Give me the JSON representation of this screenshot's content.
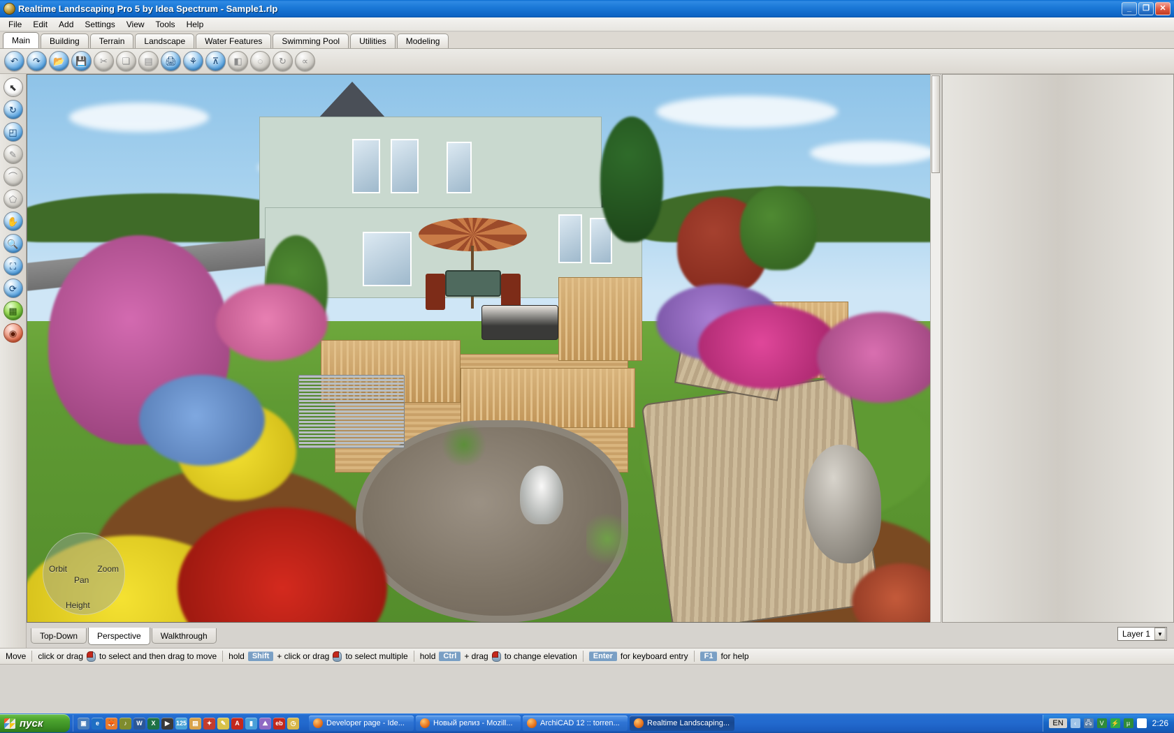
{
  "window": {
    "title": "Realtime Landscaping Pro 5 by Idea Spectrum - Sample1.rlp",
    "app_icon": "app-globe-icon",
    "controls": {
      "minimize": "_",
      "restore": "❐",
      "close": "✕"
    }
  },
  "menu": {
    "items": [
      "File",
      "Edit",
      "Add",
      "Settings",
      "View",
      "Tools",
      "Help"
    ]
  },
  "tabs": {
    "active": "Main",
    "items": [
      "Main",
      "Building",
      "Terrain",
      "Landscape",
      "Water Features",
      "Swimming Pool",
      "Utilities",
      "Modeling"
    ]
  },
  "toolbar_top": {
    "buttons": [
      {
        "name": "undo-icon",
        "glyph": "↶",
        "enabled": true
      },
      {
        "name": "redo-icon",
        "glyph": "↷",
        "enabled": true
      },
      {
        "name": "open-file-icon",
        "glyph": "📂",
        "enabled": true
      },
      {
        "name": "save-icon",
        "glyph": "💾",
        "enabled": true
      },
      {
        "name": "cut-icon",
        "glyph": "✂",
        "enabled": false
      },
      {
        "name": "copy-icon",
        "glyph": "❏",
        "enabled": false
      },
      {
        "name": "paste-icon",
        "glyph": "▤",
        "enabled": false
      },
      {
        "name": "print-icon",
        "glyph": "🖨",
        "enabled": true
      },
      {
        "name": "plant-icon",
        "glyph": "⚘",
        "enabled": true
      },
      {
        "name": "align-icon",
        "glyph": "⊼",
        "enabled": true
      },
      {
        "name": "mirror-icon",
        "glyph": "◧",
        "enabled": false
      },
      {
        "name": "shape-icon",
        "glyph": "◌",
        "enabled": false
      },
      {
        "name": "rotate-icon",
        "glyph": "↻",
        "enabled": false
      },
      {
        "name": "group-icon",
        "glyph": "∝",
        "enabled": false
      }
    ]
  },
  "toolbar_left": {
    "buttons": [
      {
        "name": "select-arrow-icon",
        "glyph": "⬉",
        "style": "white"
      },
      {
        "name": "rotate-tool-icon",
        "glyph": "↻",
        "style": "blue"
      },
      {
        "name": "scale-tool-icon",
        "glyph": "◰",
        "style": "blue"
      },
      {
        "name": "polyline-tool-icon",
        "glyph": "✎",
        "style": "dim"
      },
      {
        "name": "curve-tool-icon",
        "glyph": "⌒",
        "style": "dim"
      },
      {
        "name": "region-tool-icon",
        "glyph": "⬠",
        "style": "dim"
      },
      {
        "name": "pan-tool-icon",
        "glyph": "✋",
        "style": "blue"
      },
      {
        "name": "zoom-tool-icon",
        "glyph": "🔍",
        "style": "blue"
      },
      {
        "name": "zoom-window-icon",
        "glyph": "⛶",
        "style": "blue"
      },
      {
        "name": "orbit-tool-icon",
        "glyph": "⟳",
        "style": "blue"
      },
      {
        "name": "terrain-grid-icon",
        "glyph": "▦",
        "style": "green"
      },
      {
        "name": "render-tool-icon",
        "glyph": "◉",
        "style": "red"
      }
    ]
  },
  "viewport": {
    "nav_compass": {
      "orbit": "Orbit",
      "zoom": "Zoom",
      "pan": "Pan",
      "height": "Height"
    },
    "scene_description": "3D rendered landscape design: two-story house with wooden deck, patio umbrella, table and chairs, rock pond with fountain, flower beds, garden bench, pergola, stone boulder, mulch beds and lawn"
  },
  "view_tabs": {
    "active": "Perspective",
    "items": [
      "Top-Down",
      "Perspective",
      "Walkthrough"
    ]
  },
  "layer_selector": {
    "value": "Layer 1",
    "arrow": "▼"
  },
  "status_bar": {
    "mode": "Move",
    "hints": [
      {
        "pre": "click or drag",
        "key": "",
        "mid": "",
        "post": "to select and then drag to move",
        "mouse": true
      },
      {
        "pre": "hold",
        "key": "Shift",
        "mid": "+ click or drag",
        "post": "to select multiple",
        "mouse": true
      },
      {
        "pre": "hold",
        "key": "Ctrl",
        "mid": "+ drag",
        "post": "to change elevation",
        "mouse": true
      },
      {
        "pre": "",
        "key": "Enter",
        "mid": "",
        "post": "for keyboard entry",
        "mouse": false
      },
      {
        "pre": "",
        "key": "F1",
        "mid": "",
        "post": "for help",
        "mouse": false
      }
    ]
  },
  "taskbar": {
    "start_label": "пуск",
    "quicklaunch": [
      {
        "name": "show-desktop-icon",
        "glyph": "▣",
        "color": "#4a7ebb"
      },
      {
        "name": "internet-explorer-icon",
        "glyph": "e",
        "color": "#1f6fc4"
      },
      {
        "name": "firefox-icon",
        "glyph": "🦊",
        "color": "#e8792a"
      },
      {
        "name": "winamp-icon",
        "glyph": "♪",
        "color": "#7f8c2e"
      },
      {
        "name": "word-icon",
        "glyph": "W",
        "color": "#2b5797"
      },
      {
        "name": "excel-icon",
        "glyph": "X",
        "color": "#1e7145"
      },
      {
        "name": "media-player-icon",
        "glyph": "▶",
        "color": "#3a3a3a"
      },
      {
        "name": "k-lite-icon",
        "glyph": "125",
        "color": "#4aa3d8"
      },
      {
        "name": "explorer-folder-icon",
        "glyph": "▤",
        "color": "#d8a24a"
      },
      {
        "name": "paint-icon",
        "glyph": "✦",
        "color": "#c43c2c"
      },
      {
        "name": "notes-icon",
        "glyph": "✎",
        "color": "#d8c24a"
      },
      {
        "name": "acrobat-icon",
        "glyph": "A",
        "color": "#c4281c"
      },
      {
        "name": "battery-icon",
        "glyph": "▮",
        "color": "#4a9fd8"
      },
      {
        "name": "photo-icon",
        "glyph": "⛰",
        "color": "#8f6ac4"
      },
      {
        "name": "ebay-icon",
        "glyph": "eb",
        "color": "#c4281c"
      },
      {
        "name": "clock-icon",
        "glyph": "◷",
        "color": "#d8b84a"
      }
    ],
    "tasks": [
      {
        "label": "Developer page - Ide...",
        "icon": "firefox-icon",
        "active": false
      },
      {
        "label": "Новый релиз - Mozill...",
        "icon": "firefox-icon",
        "active": false
      },
      {
        "label": "ArchiCAD 12 :: torren...",
        "icon": "firefox-icon",
        "active": false
      },
      {
        "label": "Realtime Landscaping...",
        "icon": "app-globe-icon",
        "active": true
      }
    ],
    "tray": {
      "language": "EN",
      "icons": [
        {
          "name": "show-hidden-icons-icon",
          "glyph": "‹",
          "color": "#9fc4e8"
        },
        {
          "name": "network-icon",
          "glyph": "🖧",
          "color": "#5a7fa8"
        },
        {
          "name": "antivirus-icon",
          "glyph": "V",
          "color": "#2e8b3a"
        },
        {
          "name": "updater-icon",
          "glyph": "⚡",
          "color": "#2eaa4a"
        },
        {
          "name": "utorrent-icon",
          "glyph": "µ",
          "color": "#2e8b3a"
        },
        {
          "name": "mail-icon",
          "glyph": "✉",
          "color": "#ffffff"
        }
      ],
      "clock": "2:26"
    }
  }
}
